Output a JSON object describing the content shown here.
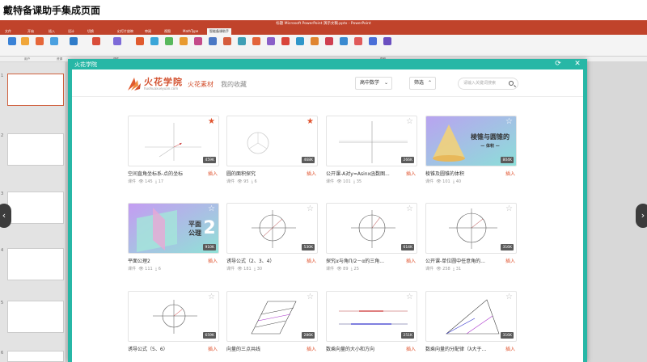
{
  "caption": "戴特备课助手集成页面",
  "window_title": "标题 Microsoft PowerPoint 演示文稿.pptx - PowerPoint",
  "ribbon_tabs": [
    "文件",
    "开始",
    "插入",
    "设计",
    "切换",
    "幻灯片放映",
    "审阅",
    "视图",
    "MathType",
    "智能备课助手"
  ],
  "ribbon_groups": [
    "用户",
    "资源",
    "课件",
    "帮助"
  ],
  "dialog": {
    "title": "火花学院",
    "refresh_icon": "refresh-icon",
    "close_icon": "close-icon"
  },
  "logo": {
    "name": "火花学院",
    "sub": "huohuaxueyuan.com"
  },
  "nav": {
    "materials": "火花素材",
    "favorites": "我的收藏"
  },
  "filters": {
    "subject": "高中数学",
    "filter": "筛选"
  },
  "search": {
    "placeholder": "请输入关键词搜索"
  },
  "colors": {
    "accent": "#27b7a6",
    "brand": "#d3512f",
    "star_active": "#e0532e"
  },
  "cards": [
    {
      "title": "空间直角坐标系-点的坐标",
      "size": "459K",
      "views": "145",
      "downloads": "17",
      "type": "课件",
      "fav": true
    },
    {
      "title": "圆的面积探究",
      "size": "468K",
      "views": "95",
      "downloads": "6",
      "type": "课件",
      "fav": true
    },
    {
      "title": "公开课-A对y=Asinx函数图...",
      "size": "266K",
      "views": "101",
      "downloads": "35",
      "type": "课件",
      "fav": false
    },
    {
      "title": "棱锥及圆锥的体积",
      "size": "804K",
      "views": "101",
      "downloads": "40",
      "type": "课件",
      "fav": false,
      "overlay": "棱锥与圆锥的",
      "overlay2": "— 体积 —"
    },
    {
      "title": "平面公理2",
      "size": "910K",
      "views": "111",
      "downloads": "6",
      "type": "课件",
      "fav": false,
      "overlay": "平面",
      "overlay2": "公理",
      "overlay3": "2"
    },
    {
      "title": "诱导公式（2、3、4）",
      "size": "530K",
      "views": "181",
      "downloads": "30",
      "type": "课件",
      "fav": false
    },
    {
      "title": "探究α与角Π/2－α的三角...",
      "size": "614K",
      "views": "89",
      "downloads": "25",
      "type": "课件",
      "fav": false
    },
    {
      "title": "公开课-单位圆中任意角的...",
      "size": "316K",
      "views": "258",
      "downloads": "31",
      "type": "课件",
      "fav": false
    },
    {
      "title": "诱导公式（5、6）",
      "size": "659K",
      "views": "",
      "downloads": "",
      "type": "",
      "fav": false
    },
    {
      "title": "向量的三点共线",
      "size": "286K",
      "views": "",
      "downloads": "",
      "type": "",
      "fav": false
    },
    {
      "title": "数乘向量的大小和方向",
      "size": "251K",
      "views": "",
      "downloads": "",
      "type": "",
      "fav": false
    },
    {
      "title": "数乘向量的分配律（λ大于...",
      "size": "316K",
      "views": "",
      "downloads": "",
      "type": "",
      "fav": false
    }
  ],
  "insert_label": "插入",
  "slide_numbers": [
    "1",
    "2",
    "3",
    "4",
    "5",
    "6"
  ]
}
